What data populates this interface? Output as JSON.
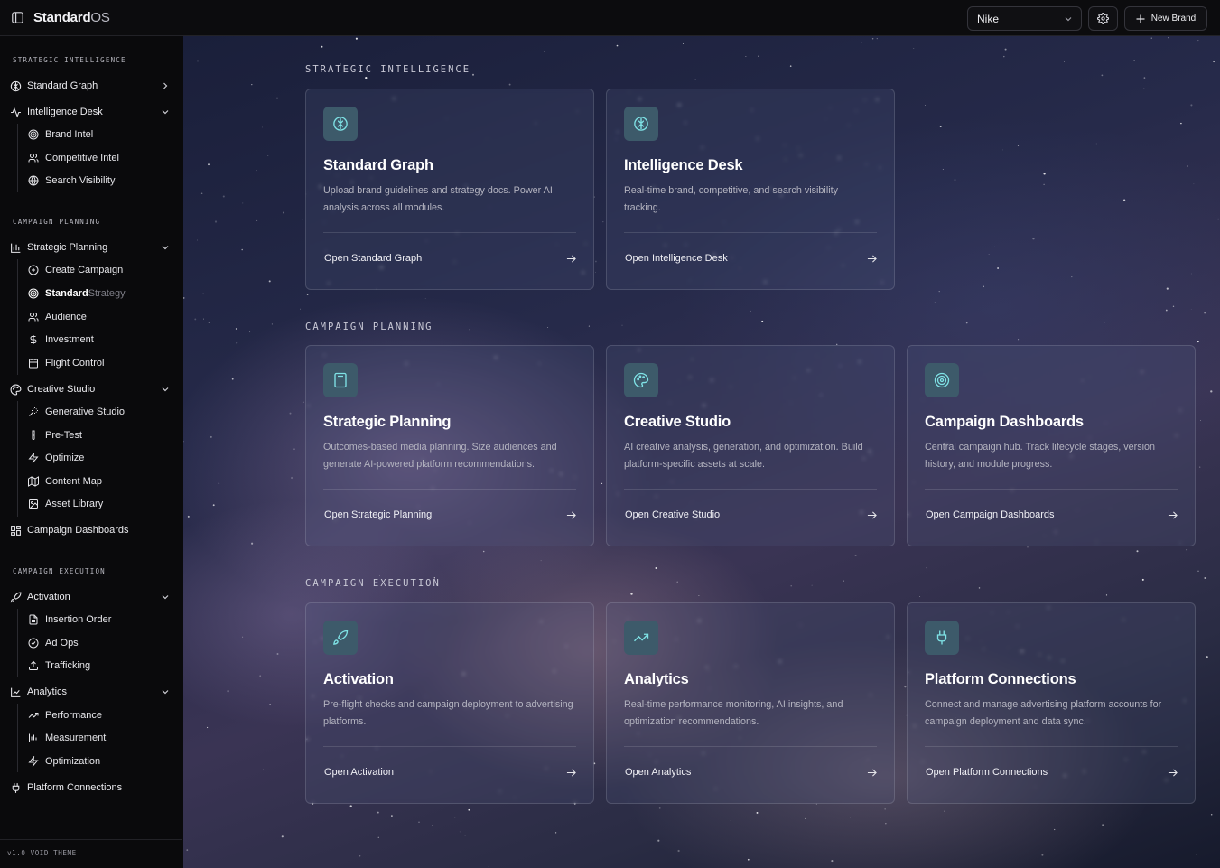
{
  "app": {
    "name_bold": "Standard",
    "name_light": "OS"
  },
  "topbar": {
    "brand_select": "Nike",
    "new_brand_label": "New Brand"
  },
  "sidebar": {
    "sections": [
      {
        "title": "STRATEGIC INTELLIGENCE"
      },
      {
        "title": "CAMPAIGN PLANNING"
      },
      {
        "title": "CAMPAIGN EXECUTION"
      }
    ],
    "items": {
      "standard_graph": "Standard Graph",
      "intelligence_desk": "Intelligence Desk",
      "brand_intel": "Brand Intel",
      "competitive_intel": "Competitive Intel",
      "search_visibility": "Search Visibility",
      "strategic_planning": "Strategic Planning",
      "create_campaign": "Create Campaign",
      "standard_strategy_bold": "Standard",
      "standard_strategy_light": "Strategy",
      "audience": "Audience",
      "investment": "Investment",
      "flight_control": "Flight Control",
      "creative_studio": "Creative Studio",
      "generative_studio": "Generative Studio",
      "pre_test": "Pre-Test",
      "optimize": "Optimize",
      "content_map": "Content Map",
      "asset_library": "Asset Library",
      "campaign_dashboards": "Campaign Dashboards",
      "activation": "Activation",
      "insertion_order": "Insertion Order",
      "ad_ops": "Ad Ops",
      "trafficking": "Trafficking",
      "analytics": "Analytics",
      "performance": "Performance",
      "measurement": "Measurement",
      "optimization": "Optimization",
      "platform_connections": "Platform Connections"
    },
    "version": "v1.0 VOID THEME"
  },
  "main": {
    "groups": [
      {
        "title": "STRATEGIC INTELLIGENCE"
      },
      {
        "title": "CAMPAIGN PLANNING"
      },
      {
        "title": "CAMPAIGN EXECUTION"
      }
    ],
    "cards": [
      {
        "icon": "brain-icon",
        "title": "Standard Graph",
        "desc": "Upload brand guidelines and strategy docs. Power AI analysis across all modules.",
        "link": "Open Standard Graph"
      },
      {
        "icon": "brain-icon",
        "title": "Intelligence Desk",
        "desc": "Real-time brand, competitive, and search visibility tracking.",
        "link": "Open Intelligence Desk"
      },
      {
        "icon": "calculator-icon",
        "title": "Strategic Planning",
        "desc": "Outcomes-based media planning. Size audiences and generate AI-powered platform recommendations.",
        "link": "Open Strategic Planning"
      },
      {
        "icon": "palette-icon",
        "title": "Creative Studio",
        "desc": "AI creative analysis, generation, and optimization. Build platform-specific assets at scale.",
        "link": "Open Creative Studio"
      },
      {
        "icon": "target-icon",
        "title": "Campaign Dashboards",
        "desc": "Central campaign hub. Track lifecycle stages, version history, and module progress.",
        "link": "Open Campaign Dashboards"
      },
      {
        "icon": "rocket-icon",
        "title": "Activation",
        "desc": "Pre-flight checks and campaign deployment to advertising platforms.",
        "link": "Open Activation"
      },
      {
        "icon": "trending-up-icon",
        "title": "Analytics",
        "desc": "Real-time performance monitoring, AI insights, and optimization recommendations.",
        "link": "Open Analytics"
      },
      {
        "icon": "plug-icon",
        "title": "Platform Connections",
        "desc": "Connect and manage advertising platform accounts for campaign deployment and data sync.",
        "link": "Open Platform Connections"
      }
    ]
  },
  "colors": {
    "accent_icon": "#7fe3e6",
    "tile_bg": "#3d5a6a"
  }
}
